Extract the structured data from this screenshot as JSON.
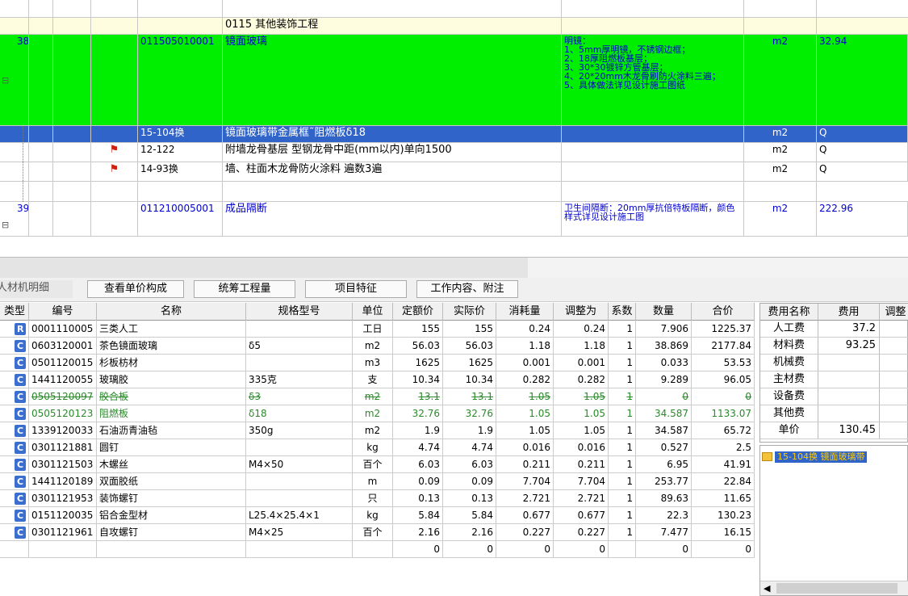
{
  "upper": {
    "section": "0115 其他装饰工程",
    "item38": {
      "seq": "38",
      "code": "011505010001",
      "name": "镜面玻璃",
      "desc": "明镜：\n1、5mm厚明镜，不锈钢边框；\n2、18厚阻燃板基层；\n3、30*30镀锌方管基层；\n4、20*20mm木龙骨刷防火涂料三遍；\n5、具体做法详见设计施工图纸",
      "unit": "m2",
      "qty": "32.94"
    },
    "sub1": {
      "code": "15-104换",
      "name": "镜面玻璃带金属框˜阻燃板δ18",
      "unit": "m2",
      "qty": "Q"
    },
    "sub2": {
      "code": "12-122",
      "name": "附墙龙骨基层 型钢龙骨中距(mm以内)单向1500",
      "unit": "m2",
      "qty": "Q"
    },
    "sub3": {
      "code": "14-93换",
      "name": "墙、柱面木龙骨防火涂料 遍数3遍",
      "unit": "m2",
      "qty": "Q"
    },
    "item39": {
      "seq": "39",
      "code": "011210005001",
      "name": "成品隔断",
      "desc": "卫生间隔断：20mm厚抗倍特板隔断，颜色样式详见设计施工图",
      "unit": "m2",
      "qty": "222.96"
    }
  },
  "tabs": [
    "人材机明细",
    "查看单价构成",
    "统筹工程量",
    "项目特征",
    "工作内容、附注"
  ],
  "grid": {
    "headers": [
      "类型",
      "编号",
      "名称",
      "规格型号",
      "单位",
      "定额价",
      "实际价",
      "消耗量",
      "调整为",
      "系数",
      "数量",
      "合价"
    ],
    "rows": [
      {
        "t": "R",
        "code": "0001110005",
        "name": "三类人工",
        "spec": "",
        "unit": "工日",
        "p1": "155",
        "p2": "155",
        "c": "0.24",
        "adj": "0.24",
        "k": "1",
        "q": "7.906",
        "sum": "1225.37",
        "style": ""
      },
      {
        "t": "C",
        "code": "0603120001",
        "name": "茶色镜面玻璃",
        "spec": "δ5",
        "unit": "m2",
        "p1": "56.03",
        "p2": "56.03",
        "c": "1.18",
        "adj": "1.18",
        "k": "1",
        "q": "38.869",
        "sum": "2177.84",
        "style": ""
      },
      {
        "t": "C",
        "code": "0501120015",
        "name": "杉板枋材",
        "spec": "",
        "unit": "m3",
        "p1": "1625",
        "p2": "1625",
        "c": "0.001",
        "adj": "0.001",
        "k": "1",
        "q": "0.033",
        "sum": "53.53",
        "style": ""
      },
      {
        "t": "C",
        "code": "1441120055",
        "name": "玻璃胶",
        "spec": "335克",
        "unit": "支",
        "p1": "10.34",
        "p2": "10.34",
        "c": "0.282",
        "adj": "0.282",
        "k": "1",
        "q": "9.289",
        "sum": "96.05",
        "style": ""
      },
      {
        "t": "C",
        "code": "0505120097",
        "name": "胶合板",
        "spec": "δ3",
        "unit": "m2",
        "p1": "13.1",
        "p2": "13.1",
        "c": "1.05",
        "adj": "1.05",
        "k": "1",
        "q": "0",
        "sum": "0",
        "style": "strike"
      },
      {
        "t": "C",
        "code": "0505120123",
        "name": "阻燃板",
        "spec": "δ18",
        "unit": "m2",
        "p1": "32.76",
        "p2": "32.76",
        "c": "1.05",
        "adj": "1.05",
        "k": "1",
        "q": "34.587",
        "sum": "1133.07",
        "style": "green"
      },
      {
        "t": "C",
        "code": "1339120033",
        "name": "石油沥青油毡",
        "spec": "350g",
        "unit": "m2",
        "p1": "1.9",
        "p2": "1.9",
        "c": "1.05",
        "adj": "1.05",
        "k": "1",
        "q": "34.587",
        "sum": "65.72",
        "style": ""
      },
      {
        "t": "C",
        "code": "0301121881",
        "name": "圆钉",
        "spec": "",
        "unit": "kg",
        "p1": "4.74",
        "p2": "4.74",
        "c": "0.016",
        "adj": "0.016",
        "k": "1",
        "q": "0.527",
        "sum": "2.5",
        "style": ""
      },
      {
        "t": "C",
        "code": "0301121503",
        "name": "木螺丝",
        "spec": "M4×50",
        "unit": "百个",
        "p1": "6.03",
        "p2": "6.03",
        "c": "0.211",
        "adj": "0.211",
        "k": "1",
        "q": "6.95",
        "sum": "41.91",
        "style": ""
      },
      {
        "t": "C",
        "code": "1441120189",
        "name": "双面胶纸",
        "spec": "",
        "unit": "m",
        "p1": "0.09",
        "p2": "0.09",
        "c": "7.704",
        "adj": "7.704",
        "k": "1",
        "q": "253.77",
        "sum": "22.84",
        "style": ""
      },
      {
        "t": "C",
        "code": "0301121953",
        "name": "装饰螺钉",
        "spec": "",
        "unit": "只",
        "p1": "0.13",
        "p2": "0.13",
        "c": "2.721",
        "adj": "2.721",
        "k": "1",
        "q": "89.63",
        "sum": "11.65",
        "style": ""
      },
      {
        "t": "C",
        "code": "0151120035",
        "name": "铝合金型材",
        "spec": "L25.4×25.4×1",
        "unit": "kg",
        "p1": "5.84",
        "p2": "5.84",
        "c": "0.677",
        "adj": "0.677",
        "k": "1",
        "q": "22.3",
        "sum": "130.23",
        "style": ""
      },
      {
        "t": "C",
        "code": "0301121961",
        "name": "自攻螺钉",
        "spec": "M4×25",
        "unit": "百个",
        "p1": "2.16",
        "p2": "2.16",
        "c": "0.227",
        "adj": "0.227",
        "k": "1",
        "q": "7.477",
        "sum": "16.15",
        "style": ""
      },
      {
        "t": "",
        "code": "",
        "name": "",
        "spec": "",
        "unit": "",
        "p1": "0",
        "p2": "0",
        "c": "0",
        "adj": "0",
        "k": "",
        "q": "0",
        "sum": "0",
        "style": ""
      }
    ]
  },
  "fee": {
    "headers": [
      "费用名称",
      "费用",
      "调整"
    ],
    "rows": [
      [
        "人工费",
        "37.2"
      ],
      [
        "材料费",
        "93.25"
      ],
      [
        "机械费",
        ""
      ],
      [
        "主材费",
        ""
      ],
      [
        "设备费",
        ""
      ],
      [
        "其他费",
        ""
      ],
      [
        "单价",
        "130.45"
      ]
    ]
  },
  "tree": {
    "node": "15-104换 镜面玻璃带"
  },
  "colors": {
    "selected": "#3064c8",
    "highlight": "#00ee00",
    "badge": "#3a6fd0"
  }
}
